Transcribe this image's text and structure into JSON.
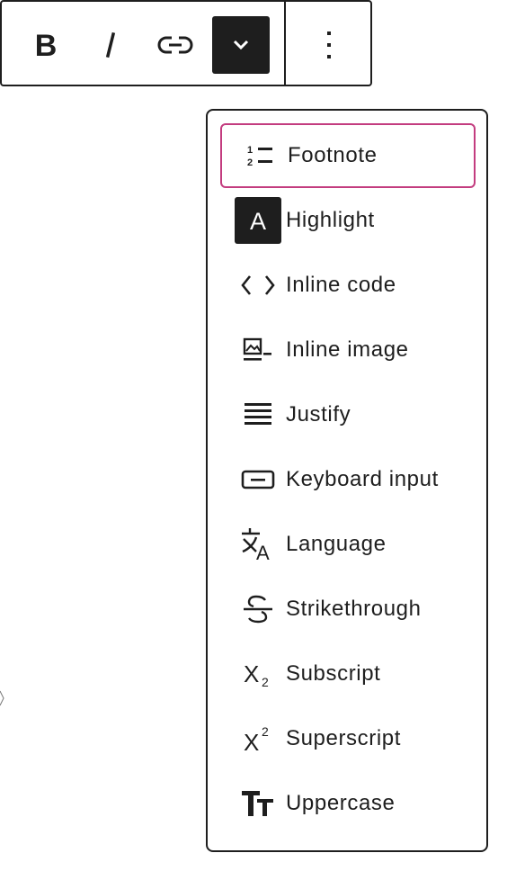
{
  "toolbar": {
    "buttons": [
      {
        "name": "bold",
        "icon": "bold-icon"
      },
      {
        "name": "italic",
        "icon": "italic-icon"
      },
      {
        "name": "link",
        "icon": "link-icon"
      },
      {
        "name": "more-rich-text",
        "icon": "chevron-down-icon",
        "pressed": true
      },
      {
        "name": "options",
        "icon": "more-vertical-icon"
      }
    ]
  },
  "menu": {
    "items": [
      {
        "label": "Footnote",
        "icon": "footnote-icon",
        "focused": true
      },
      {
        "label": "Highlight",
        "icon": "highlight-icon"
      },
      {
        "label": "Inline code",
        "icon": "code-icon"
      },
      {
        "label": "Inline image",
        "icon": "inline-image-icon"
      },
      {
        "label": "Justify",
        "icon": "justify-icon"
      },
      {
        "label": "Keyboard input",
        "icon": "keyboard-icon"
      },
      {
        "label": "Language",
        "icon": "language-icon"
      },
      {
        "label": "Strikethrough",
        "icon": "strikethrough-icon"
      },
      {
        "label": "Subscript",
        "icon": "subscript-icon"
      },
      {
        "label": "Superscript",
        "icon": "superscript-icon"
      },
      {
        "label": "Uppercase",
        "icon": "uppercase-icon"
      }
    ]
  },
  "colors": {
    "foreground": "#1e1e1e",
    "focus_ring": "#c33c7f",
    "background": "#ffffff"
  }
}
